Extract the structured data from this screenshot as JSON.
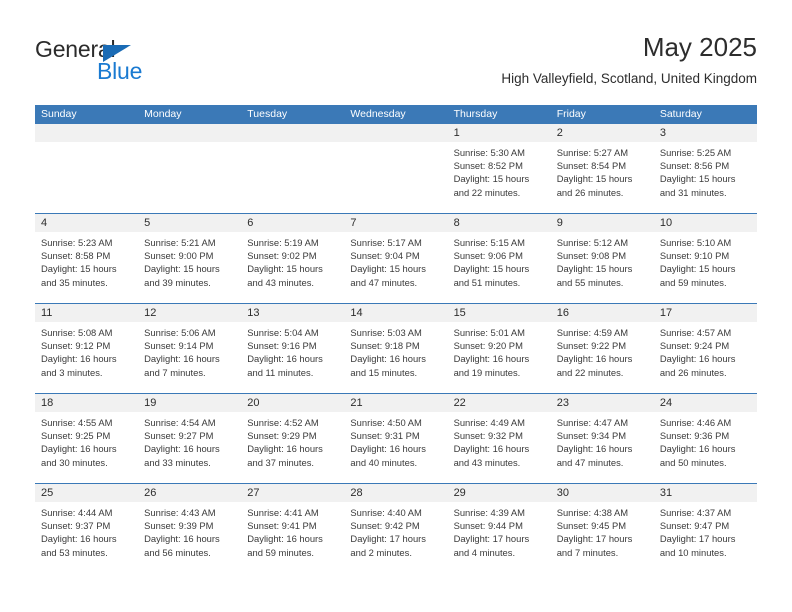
{
  "brand": {
    "name_top": "General",
    "name_bottom": "Blue",
    "accent_color": "#1a7ad1",
    "triangle_color": "#1a6bb5"
  },
  "header": {
    "title": "May 2025",
    "subtitle": "High Valleyfield, Scotland, United Kingdom"
  },
  "calendar": {
    "header_color": "#3b79b7",
    "weekdays": [
      "Sunday",
      "Monday",
      "Tuesday",
      "Wednesday",
      "Thursday",
      "Friday",
      "Saturday"
    ],
    "weeks": [
      [
        {
          "day": "",
          "sunrise": "",
          "sunset": "",
          "daylight_1": "",
          "daylight_2": ""
        },
        {
          "day": "",
          "sunrise": "",
          "sunset": "",
          "daylight_1": "",
          "daylight_2": ""
        },
        {
          "day": "",
          "sunrise": "",
          "sunset": "",
          "daylight_1": "",
          "daylight_2": ""
        },
        {
          "day": "",
          "sunrise": "",
          "sunset": "",
          "daylight_1": "",
          "daylight_2": ""
        },
        {
          "day": "1",
          "sunrise": "Sunrise: 5:30 AM",
          "sunset": "Sunset: 8:52 PM",
          "daylight_1": "Daylight: 15 hours",
          "daylight_2": "and 22 minutes."
        },
        {
          "day": "2",
          "sunrise": "Sunrise: 5:27 AM",
          "sunset": "Sunset: 8:54 PM",
          "daylight_1": "Daylight: 15 hours",
          "daylight_2": "and 26 minutes."
        },
        {
          "day": "3",
          "sunrise": "Sunrise: 5:25 AM",
          "sunset": "Sunset: 8:56 PM",
          "daylight_1": "Daylight: 15 hours",
          "daylight_2": "and 31 minutes."
        }
      ],
      [
        {
          "day": "4",
          "sunrise": "Sunrise: 5:23 AM",
          "sunset": "Sunset: 8:58 PM",
          "daylight_1": "Daylight: 15 hours",
          "daylight_2": "and 35 minutes."
        },
        {
          "day": "5",
          "sunrise": "Sunrise: 5:21 AM",
          "sunset": "Sunset: 9:00 PM",
          "daylight_1": "Daylight: 15 hours",
          "daylight_2": "and 39 minutes."
        },
        {
          "day": "6",
          "sunrise": "Sunrise: 5:19 AM",
          "sunset": "Sunset: 9:02 PM",
          "daylight_1": "Daylight: 15 hours",
          "daylight_2": "and 43 minutes."
        },
        {
          "day": "7",
          "sunrise": "Sunrise: 5:17 AM",
          "sunset": "Sunset: 9:04 PM",
          "daylight_1": "Daylight: 15 hours",
          "daylight_2": "and 47 minutes."
        },
        {
          "day": "8",
          "sunrise": "Sunrise: 5:15 AM",
          "sunset": "Sunset: 9:06 PM",
          "daylight_1": "Daylight: 15 hours",
          "daylight_2": "and 51 minutes."
        },
        {
          "day": "9",
          "sunrise": "Sunrise: 5:12 AM",
          "sunset": "Sunset: 9:08 PM",
          "daylight_1": "Daylight: 15 hours",
          "daylight_2": "and 55 minutes."
        },
        {
          "day": "10",
          "sunrise": "Sunrise: 5:10 AM",
          "sunset": "Sunset: 9:10 PM",
          "daylight_1": "Daylight: 15 hours",
          "daylight_2": "and 59 minutes."
        }
      ],
      [
        {
          "day": "11",
          "sunrise": "Sunrise: 5:08 AM",
          "sunset": "Sunset: 9:12 PM",
          "daylight_1": "Daylight: 16 hours",
          "daylight_2": "and 3 minutes."
        },
        {
          "day": "12",
          "sunrise": "Sunrise: 5:06 AM",
          "sunset": "Sunset: 9:14 PM",
          "daylight_1": "Daylight: 16 hours",
          "daylight_2": "and 7 minutes."
        },
        {
          "day": "13",
          "sunrise": "Sunrise: 5:04 AM",
          "sunset": "Sunset: 9:16 PM",
          "daylight_1": "Daylight: 16 hours",
          "daylight_2": "and 11 minutes."
        },
        {
          "day": "14",
          "sunrise": "Sunrise: 5:03 AM",
          "sunset": "Sunset: 9:18 PM",
          "daylight_1": "Daylight: 16 hours",
          "daylight_2": "and 15 minutes."
        },
        {
          "day": "15",
          "sunrise": "Sunrise: 5:01 AM",
          "sunset": "Sunset: 9:20 PM",
          "daylight_1": "Daylight: 16 hours",
          "daylight_2": "and 19 minutes."
        },
        {
          "day": "16",
          "sunrise": "Sunrise: 4:59 AM",
          "sunset": "Sunset: 9:22 PM",
          "daylight_1": "Daylight: 16 hours",
          "daylight_2": "and 22 minutes."
        },
        {
          "day": "17",
          "sunrise": "Sunrise: 4:57 AM",
          "sunset": "Sunset: 9:24 PM",
          "daylight_1": "Daylight: 16 hours",
          "daylight_2": "and 26 minutes."
        }
      ],
      [
        {
          "day": "18",
          "sunrise": "Sunrise: 4:55 AM",
          "sunset": "Sunset: 9:25 PM",
          "daylight_1": "Daylight: 16 hours",
          "daylight_2": "and 30 minutes."
        },
        {
          "day": "19",
          "sunrise": "Sunrise: 4:54 AM",
          "sunset": "Sunset: 9:27 PM",
          "daylight_1": "Daylight: 16 hours",
          "daylight_2": "and 33 minutes."
        },
        {
          "day": "20",
          "sunrise": "Sunrise: 4:52 AM",
          "sunset": "Sunset: 9:29 PM",
          "daylight_1": "Daylight: 16 hours",
          "daylight_2": "and 37 minutes."
        },
        {
          "day": "21",
          "sunrise": "Sunrise: 4:50 AM",
          "sunset": "Sunset: 9:31 PM",
          "daylight_1": "Daylight: 16 hours",
          "daylight_2": "and 40 minutes."
        },
        {
          "day": "22",
          "sunrise": "Sunrise: 4:49 AM",
          "sunset": "Sunset: 9:32 PM",
          "daylight_1": "Daylight: 16 hours",
          "daylight_2": "and 43 minutes."
        },
        {
          "day": "23",
          "sunrise": "Sunrise: 4:47 AM",
          "sunset": "Sunset: 9:34 PM",
          "daylight_1": "Daylight: 16 hours",
          "daylight_2": "and 47 minutes."
        },
        {
          "day": "24",
          "sunrise": "Sunrise: 4:46 AM",
          "sunset": "Sunset: 9:36 PM",
          "daylight_1": "Daylight: 16 hours",
          "daylight_2": "and 50 minutes."
        }
      ],
      [
        {
          "day": "25",
          "sunrise": "Sunrise: 4:44 AM",
          "sunset": "Sunset: 9:37 PM",
          "daylight_1": "Daylight: 16 hours",
          "daylight_2": "and 53 minutes."
        },
        {
          "day": "26",
          "sunrise": "Sunrise: 4:43 AM",
          "sunset": "Sunset: 9:39 PM",
          "daylight_1": "Daylight: 16 hours",
          "daylight_2": "and 56 minutes."
        },
        {
          "day": "27",
          "sunrise": "Sunrise: 4:41 AM",
          "sunset": "Sunset: 9:41 PM",
          "daylight_1": "Daylight: 16 hours",
          "daylight_2": "and 59 minutes."
        },
        {
          "day": "28",
          "sunrise": "Sunrise: 4:40 AM",
          "sunset": "Sunset: 9:42 PM",
          "daylight_1": "Daylight: 17 hours",
          "daylight_2": "and 2 minutes."
        },
        {
          "day": "29",
          "sunrise": "Sunrise: 4:39 AM",
          "sunset": "Sunset: 9:44 PM",
          "daylight_1": "Daylight: 17 hours",
          "daylight_2": "and 4 minutes."
        },
        {
          "day": "30",
          "sunrise": "Sunrise: 4:38 AM",
          "sunset": "Sunset: 9:45 PM",
          "daylight_1": "Daylight: 17 hours",
          "daylight_2": "and 7 minutes."
        },
        {
          "day": "31",
          "sunrise": "Sunrise: 4:37 AM",
          "sunset": "Sunset: 9:47 PM",
          "daylight_1": "Daylight: 17 hours",
          "daylight_2": "and 10 minutes."
        }
      ]
    ]
  }
}
